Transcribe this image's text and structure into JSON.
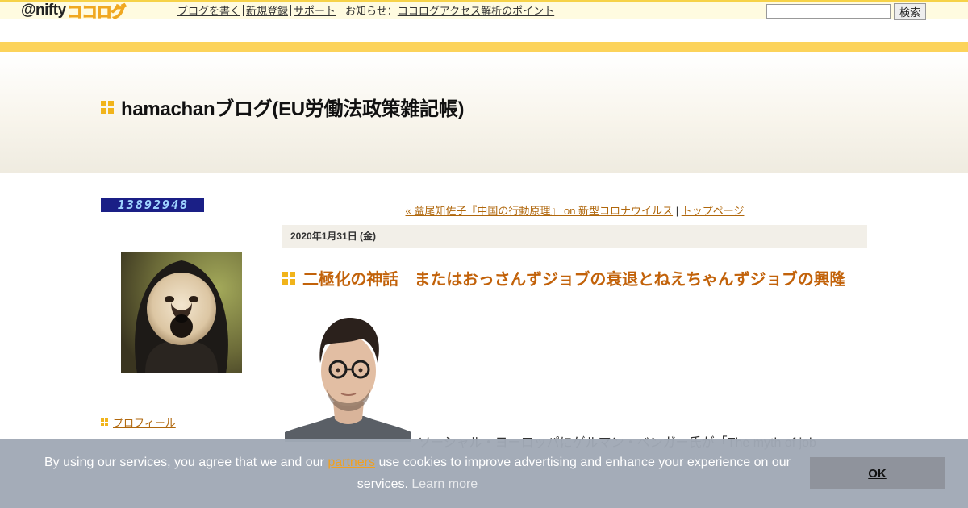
{
  "topbar": {
    "logo_prefix": "@nifty",
    "logo_brand": "ココログ",
    "nav": [
      {
        "label": "ブログを書く"
      },
      {
        "label": "新規登録"
      },
      {
        "label": "サポート"
      }
    ],
    "news_label": "お知らせ",
    "news_colon": "：",
    "news_link": "ココログアクセス解析のポイント",
    "search_value": "",
    "search_button": "検索"
  },
  "header": {
    "site_title": "hamachanブログ(EU労働法政策雑記帳)"
  },
  "sidebar": {
    "counter_digits": "13892948",
    "profile_link": "プロフィール"
  },
  "main": {
    "prev_link": "« 益尾知佐子『中国の行動原理』 on 新型コロナウイルス",
    "pager_sep": "|",
    "top_link": "トップページ",
    "date": "2020年1月31日 (金)",
    "entry_title": "二極化の神話　またはおっさんずジョブの衰退とねえちゃんずジョブの興隆",
    "entry_text_start": "ソーシャル・ヨーロッパにゲルマン・ベンガー氏が「The myth of job"
  },
  "cookie": {
    "text_before": "By using our services, you agree that we and our ",
    "partners_link": "partners",
    "text_after": " use cookies to improve advertising and enhance your experience on our services. ",
    "learn_more": "Learn more",
    "ok": "OK"
  },
  "colors": {
    "accent_yellow": "#fcd35b",
    "icon_gold": "#f1b41b",
    "title_orange": "#c2620a",
    "link_orange": "#b0670c",
    "counter_bg": "#1a1f86",
    "cookie_bg": "#a0a9b5"
  },
  "icons": {
    "title_bullet": "four-squares-icon",
    "profile_bullet": "four-squares-icon"
  }
}
